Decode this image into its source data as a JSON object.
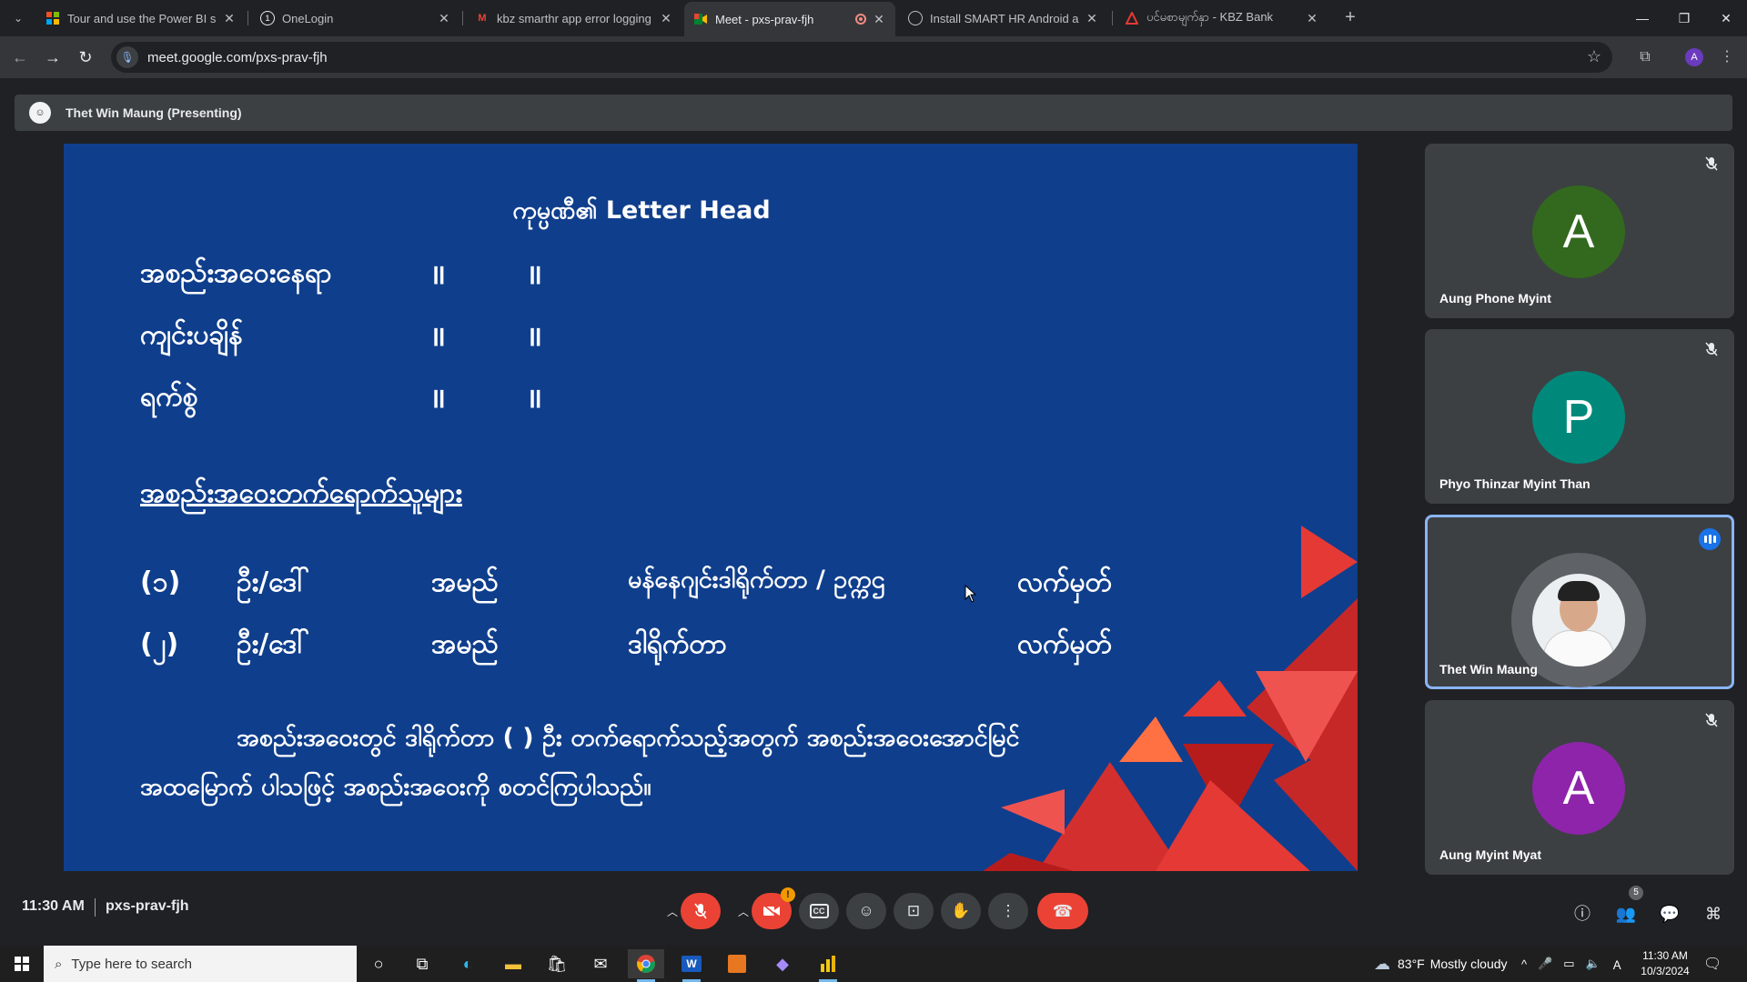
{
  "browser": {
    "tabs": [
      {
        "title": "Tour and use the Power BI servi",
        "icon": "power-bi-icon"
      },
      {
        "title": "OneLogin",
        "icon": "onelogin-icon"
      },
      {
        "title": "kbz smarthr app error logging i",
        "icon": "gmail-icon"
      },
      {
        "title": "Meet - pxs-prav-fjh",
        "icon": "google-meet-icon",
        "active": true,
        "recording": true
      },
      {
        "title": "Install SMART HR Android app",
        "icon": "globe-icon"
      },
      {
        "title": "ပင်မစာမျက်နှာ - KBZ Bank",
        "icon": "kbz-bank-icon"
      }
    ],
    "url": "meet.google.com/pxs-prav-fjh",
    "profile_initial": "A"
  },
  "meet": {
    "presenter_label": "Thet Win Maung (Presenting)",
    "slide": {
      "title": "ကုမ္ပဏီ၏ Letter Head",
      "rows": [
        {
          "label": "အစည်းအဝေးနေရာ",
          "q1": "॥",
          "q2": "॥"
        },
        {
          "label": "ကျင်းပချိန်",
          "q1": "॥",
          "q2": "॥"
        },
        {
          "label": "ရက်စွဲ",
          "q1": "॥",
          "q2": "॥"
        }
      ],
      "attendees_heading": "အစည်းအဝေးတက်ရောက်သူများ",
      "attendees": [
        {
          "num": "(၁)",
          "prefix": "ဦး/ဒေါ်",
          "name": "အမည်",
          "role": "မန်နေဂျင်းဒါရိုက်တာ / ဥက္ကဌ",
          "sign": "လက်မှတ်"
        },
        {
          "num": "(၂)",
          "prefix": "ဦး/ဒေါ်",
          "name": "အမည်",
          "role": "ဒါရိုက်တာ",
          "sign": "လက်မှတ်"
        }
      ],
      "para_line1": "အစည်းအဝေးတွင် ဒါရိုက်တာ (   ) ဦး တက်ရောက်သည့်အတွက် အစည်းအဝေးအောင်မြင်",
      "para_line2": "အထမြောက် ပါသဖြင့် အစည်းအဝေးကို စတင်ကြပါသည်။"
    },
    "participants": [
      {
        "name": "Aung Phone Myint",
        "initial": "A",
        "color": "#33691e",
        "muted": true
      },
      {
        "name": "Phyo Thinzar Myint Than",
        "initial": "P",
        "color": "#00897b",
        "muted": true
      },
      {
        "name": "Thet Win Maung",
        "initial": "",
        "photo": true,
        "speaking": true
      },
      {
        "name": "Aung Myint Myat",
        "initial": "A",
        "color": "#8e24aa",
        "muted": true
      }
    ],
    "time": "11:30 AM",
    "meeting_code": "pxs-prav-fjh",
    "participant_count": "5",
    "camera_warning": "!"
  },
  "taskbar": {
    "search_placeholder": "Type here to search",
    "weather_temp": "83°F",
    "weather_text": "Mostly cloudy",
    "time": "11:30 AM",
    "date": "10/3/2024"
  }
}
